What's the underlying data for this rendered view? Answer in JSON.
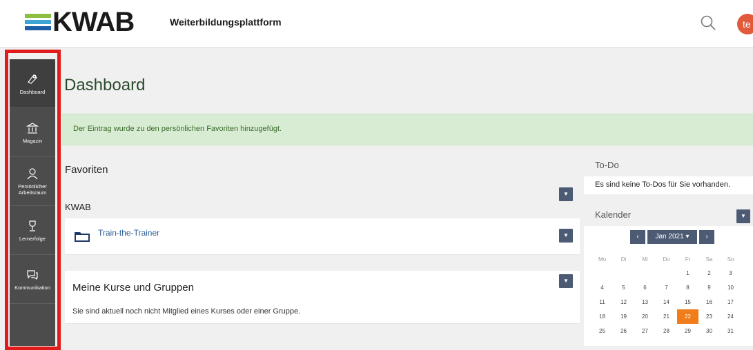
{
  "header": {
    "logo_text": "KWAB",
    "logo_colors": [
      "#8cbf3f",
      "#3da4d4",
      "#1d5fa8"
    ],
    "platform": "Weiterbildungsplattform",
    "search_icon": "search-icon",
    "avatar_text": "te",
    "avatar_color": "#e25a3c"
  },
  "sidebar": {
    "highlight_color": "#e01b1b",
    "items": [
      {
        "label": "Dashboard",
        "icon": "dashboard-icon"
      },
      {
        "label": "Magazin",
        "icon": "bank-icon"
      },
      {
        "label": "Persönlicher\nArbeitsraum",
        "icon": "person-icon"
      },
      {
        "label": "Lernerfolge",
        "icon": "trophy-icon"
      },
      {
        "label": "Kommunikation",
        "icon": "chat-icon"
      }
    ]
  },
  "main": {
    "title": "Dashboard",
    "alert": "Der Eintrag wurde zu den persönlichen Favoriten hinzugefügt.",
    "favorites": {
      "title": "Favoriten",
      "group": "KWAB",
      "items": [
        {
          "label": "Train-the-Trainer",
          "icon": "folder-icon"
        }
      ]
    },
    "courses": {
      "title": "Meine Kurse und Gruppen",
      "text": "Sie sind aktuell noch nicht Mitglied eines Kurses oder einer Gruppe."
    }
  },
  "todo": {
    "title": "To-Do",
    "text": "Es sind keine To-Dos für Sie vorhanden."
  },
  "calendar": {
    "title": "Kalender",
    "prev": "‹",
    "month": "Jan 2021 ▾",
    "next": "›",
    "weekdays": [
      "Mo",
      "Di",
      "Mi",
      "Do",
      "Fr",
      "Sa",
      "So"
    ],
    "weeks": [
      [
        "",
        "",
        "",
        "",
        "1",
        "2",
        "3"
      ],
      [
        "4",
        "5",
        "6",
        "7",
        "8",
        "9",
        "10"
      ],
      [
        "11",
        "12",
        "13",
        "14",
        "15",
        "16",
        "17"
      ],
      [
        "18",
        "19",
        "20",
        "21",
        "22",
        "23",
        "24"
      ],
      [
        "25",
        "26",
        "27",
        "28",
        "29",
        "30",
        "31"
      ]
    ],
    "today": "22",
    "today_color": "#f07d1a"
  }
}
